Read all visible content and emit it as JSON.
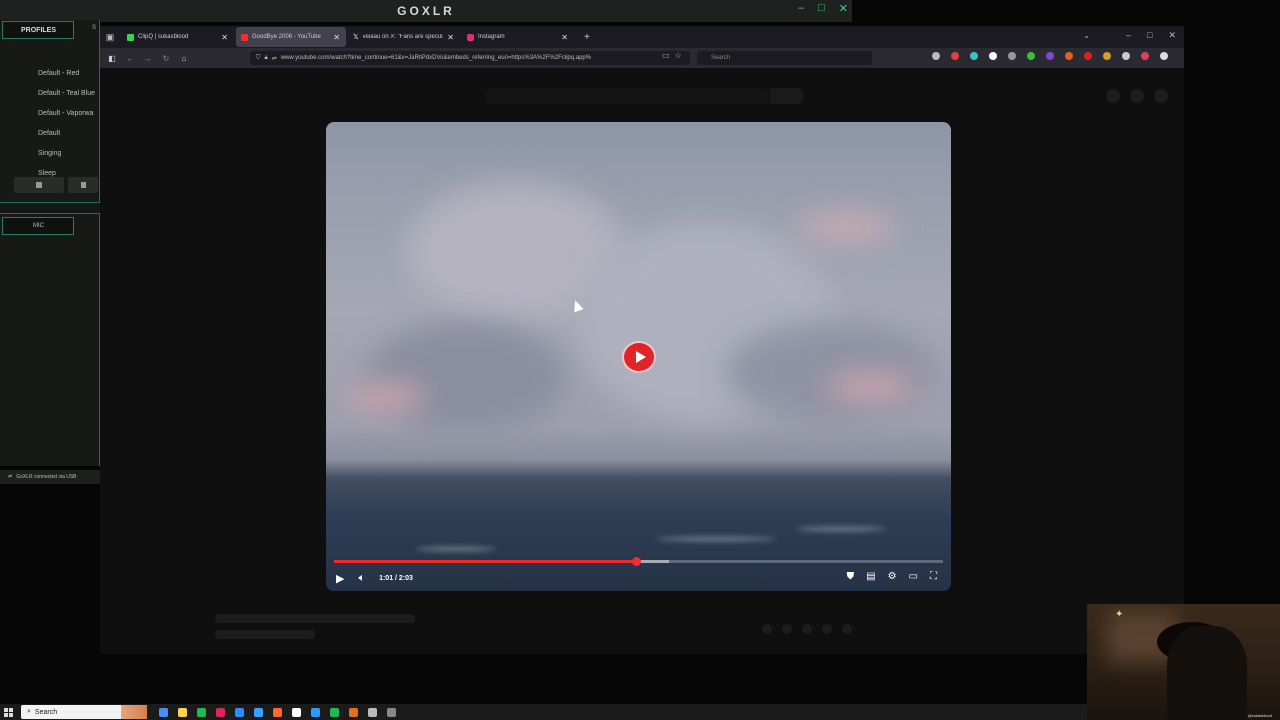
{
  "goxlr": {
    "logo": "GOXLR",
    "window_buttons": [
      "–",
      "□",
      "✕"
    ],
    "profiles_tab": "PROFILES",
    "second_tab": "S",
    "profiles": [
      "Default - Red",
      "Default - Teal Blue",
      "Default - Vaporwa",
      "Default",
      "Singing",
      "Sleep"
    ],
    "mic_tab": "MIC",
    "status": "GoXLR connected via USB"
  },
  "browser": {
    "tabs": [
      {
        "label": "ClipQ | sukasblood",
        "icon_color": "#39d353",
        "close": "✕"
      },
      {
        "label": "GoodBye 2006 - YouTube",
        "icon_color": "#ff2a2a",
        "close": "✕",
        "active": true
      },
      {
        "label": "veiaau on X: \"Fans are speculati",
        "icon_color": "#ffffff",
        "close": "✕"
      },
      {
        "label": "Instagram",
        "icon_color": "#e1306c",
        "close": "✕"
      }
    ],
    "new_tab": "+",
    "tab_list": "⌄",
    "window_buttons": [
      "–",
      "□",
      "✕"
    ],
    "url": "www.youtube.com/watch?time_continue=61&v=JaRtiPdxDVo&embeds_referring_euri=https%3A%2F%2Fclipq.app%",
    "search_placeholder": "Search",
    "extension_colors": [
      "#bbbbbb",
      "#e04040",
      "#3cc4c4",
      "#ffffff",
      "#999999",
      "#3cc03c",
      "#7a4ad8",
      "#e06020",
      "#e02020",
      "#d8a020",
      "#cccccc",
      "#e04060",
      "#dddddd"
    ]
  },
  "player": {
    "time": "1:01 / 2:03",
    "progress": 0.496,
    "buffered": 0.55
  },
  "webcam": {
    "label": "@sukasblood"
  },
  "taskbar": {
    "search_label": "Search",
    "app_colors": [
      "#4a8cff",
      "#ffd34d",
      "#1db954",
      "#e0245e",
      "#2a8cff",
      "#3aa0ff",
      "#ff6a2a",
      "#ffffff",
      "#2a9cff",
      "#1db954",
      "#e07020",
      "#bbbbbb",
      "#888888"
    ]
  }
}
